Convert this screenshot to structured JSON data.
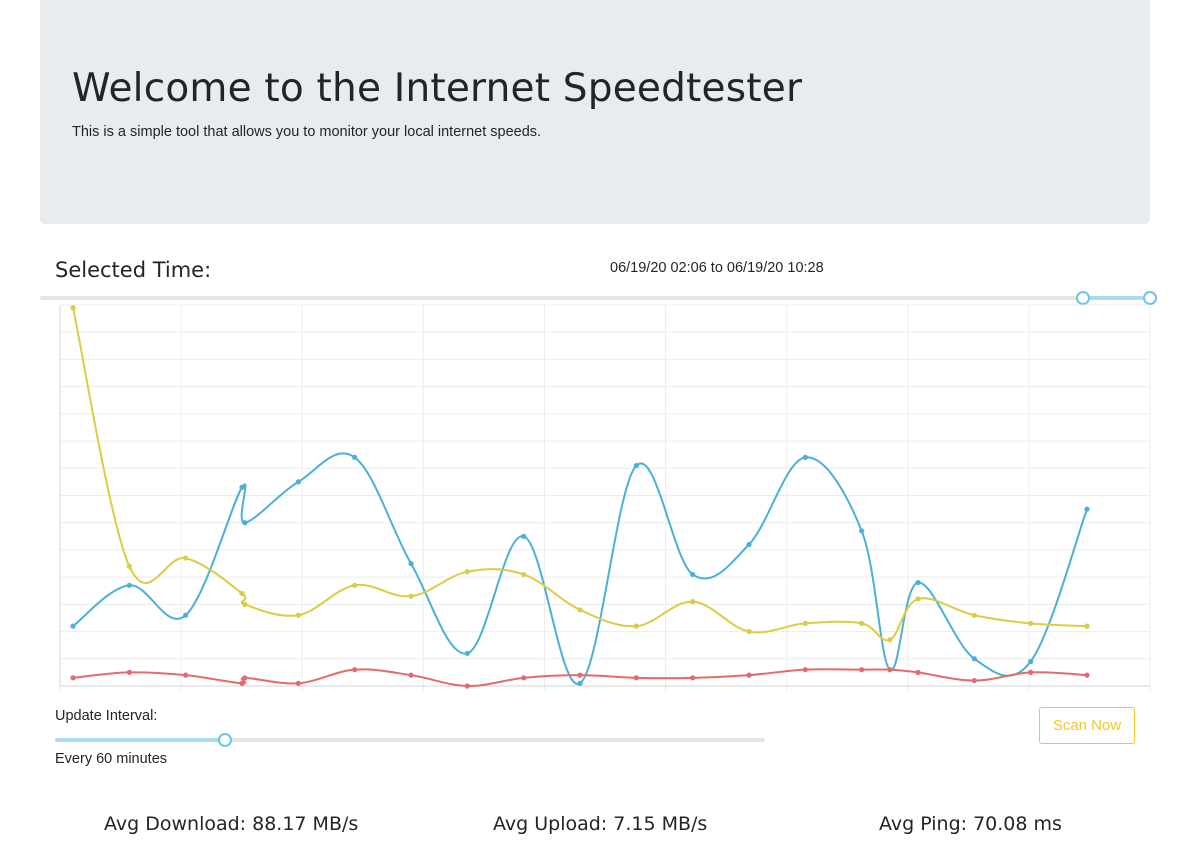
{
  "header": {
    "title": "Welcome to the Internet Speedtester",
    "subtitle": "This is a simple tool that allows you to monitor your local internet speeds."
  },
  "time_selection": {
    "label": "Selected Time:",
    "range_text": "06/19/20 02:06 to 06/19/20 10:28",
    "selected_start_fraction": 0.94,
    "selected_end_fraction": 1.0
  },
  "controls": {
    "interval_label": "Update Interval:",
    "interval_text": "Every 60 minutes",
    "interval_fraction": 0.24,
    "scan_button": "Scan Now"
  },
  "stats": {
    "download": "Avg Download: 88.17 MB/s",
    "upload": "Avg Upload: 7.15 MB/s",
    "ping": "Avg Ping: 70.08 ms"
  },
  "chart_data": {
    "type": "line",
    "x": [
      0,
      1,
      2,
      3,
      3.05,
      4,
      5,
      6,
      7,
      8,
      9,
      10,
      11,
      12,
      13,
      14,
      14.5,
      15,
      16,
      17,
      18
    ],
    "ylim": [
      0,
      140
    ],
    "grid": true,
    "series": [
      {
        "color": "#4bb0d8",
        "values": [
          22,
          37,
          26,
          73,
          60,
          75,
          84,
          45,
          12,
          55,
          1,
          81,
          41,
          52,
          84,
          57,
          6,
          38,
          10,
          9,
          65
        ]
      },
      {
        "color": "#dccb45",
        "values": [
          139,
          44,
          47,
          34,
          30,
          26,
          37,
          33,
          42,
          41,
          28,
          22,
          31,
          20,
          23,
          23,
          17,
          32,
          26,
          23,
          22
        ]
      },
      {
        "color": "#e56b6b",
        "values": [
          3,
          5,
          4,
          1,
          3,
          1,
          6,
          4,
          0,
          3,
          4,
          3,
          3,
          4,
          6,
          6,
          6,
          5,
          2,
          5,
          4
        ]
      }
    ]
  }
}
